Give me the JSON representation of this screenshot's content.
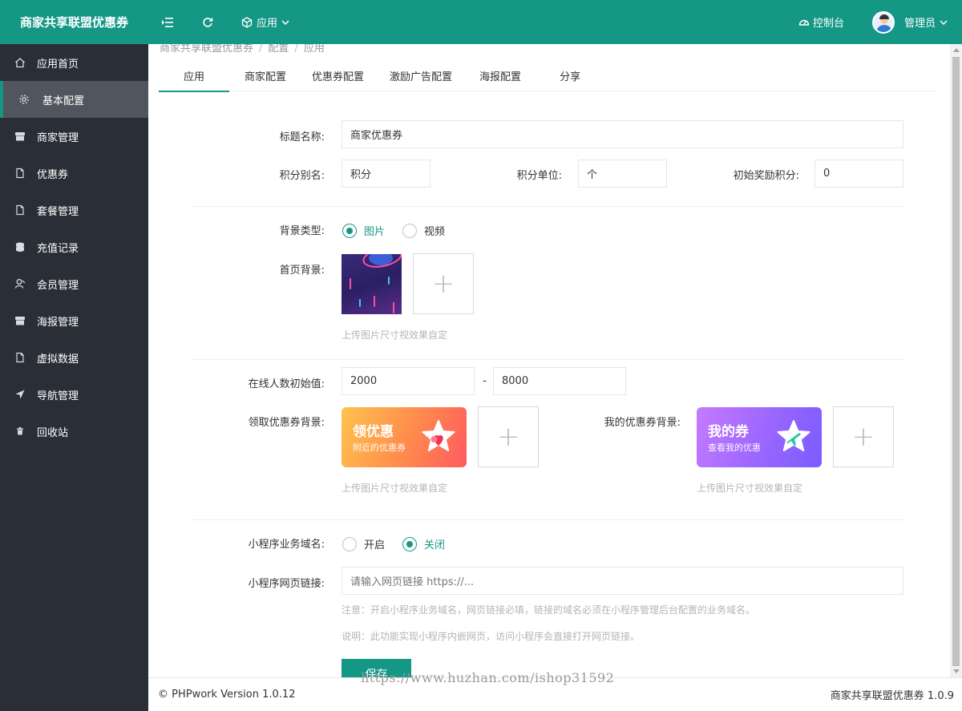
{
  "header": {
    "app_title": "商家共享联盟优惠券",
    "apps_menu_label": "应用",
    "dashboard_label": "控制台",
    "user_label": "管理员"
  },
  "sidebar": {
    "items": [
      {
        "label": "应用首页",
        "icon": "home-icon"
      },
      {
        "label": "基本配置",
        "icon": "gear-icon",
        "active": true
      },
      {
        "label": "商家管理",
        "icon": "store-icon"
      },
      {
        "label": "优惠券",
        "icon": "file-icon"
      },
      {
        "label": "套餐管理",
        "icon": "file-icon"
      },
      {
        "label": "充值记录",
        "icon": "coins-icon"
      },
      {
        "label": "会员管理",
        "icon": "user-icon"
      },
      {
        "label": "海报管理",
        "icon": "store-icon"
      },
      {
        "label": "虚拟数据",
        "icon": "file-icon"
      },
      {
        "label": "导航管理",
        "icon": "location-arrow-icon"
      },
      {
        "label": "回收站",
        "icon": "trash-icon"
      }
    ]
  },
  "breadcrumb": [
    "商家共享联盟优惠券",
    "配置",
    "应用"
  ],
  "tabs": [
    "应用",
    "商家配置",
    "优惠券配置",
    "激励广告配置",
    "海报配置",
    "分享"
  ],
  "form": {
    "title_label": "标题名称:",
    "title_value": "商家优惠券",
    "points_alias_label": "积分别名:",
    "points_alias_value": "积分",
    "points_unit_label": "积分单位:",
    "points_unit_value": "个",
    "initial_points_label": "初始奖励积分:",
    "initial_points_value": "0",
    "bg_type_label": "背景类型:",
    "bg_type_options": [
      "图片",
      "视频"
    ],
    "bg_type_selected": "图片",
    "home_bg_label": "首页背景:",
    "upload_hint": "上传图片尺寸视效果自定",
    "online_label": "在线人数初始值:",
    "online_min": "2000",
    "online_sep": "-",
    "online_max": "8000",
    "claim_bg_label": "领取优惠券背景:",
    "claim_banner_title": "领优惠",
    "claim_banner_sub": "附近的优惠券",
    "my_bg_label": "我的优惠券背景:",
    "my_banner_title": "我的券",
    "my_banner_sub": "查看我的优惠",
    "domain_label": "小程序业务域名:",
    "domain_options": [
      "开启",
      "关闭"
    ],
    "domain_selected": "关闭",
    "link_label": "小程序网页链接:",
    "link_placeholder": "请输入网页链接 https://...",
    "note1": "注意：开启小程序业务域名，网页链接必填，链接的域名必须在小程序管理后台配置的业务域名。",
    "note2": "说明：此功能实现小程序内嵌网页，访问小程序会直接打开网页链接。",
    "save_label": "保存"
  },
  "watermark": "https://www.huzhan.com/ishop31592",
  "footer": {
    "left": "© PHPwork Version 1.0.12",
    "right": "商家共享联盟优惠券 1.0.9"
  },
  "colors": {
    "brand": "#159786",
    "sidebar_bg": "#2a2f37",
    "claim_banner_from": "#ffb84d",
    "claim_banner_to": "#ff5a5f",
    "my_banner_from": "#b36cff",
    "my_banner_to": "#7a5cff"
  }
}
